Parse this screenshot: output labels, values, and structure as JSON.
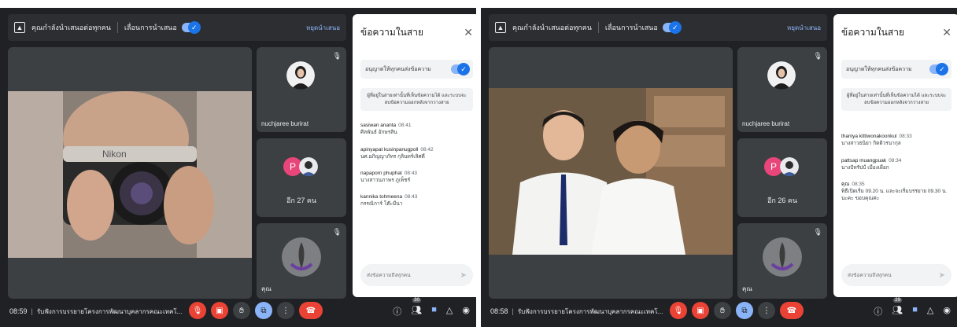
{
  "panes": [
    {
      "banner": {
        "text": "คุณกำลังนำเสนอต่อทุกคน",
        "toggle_label": "เลื่อนการนำเสนอ",
        "stop_label": "หยุดนำเสนอ"
      },
      "tiles": [
        {
          "name": "nuchjaree burirat"
        },
        {
          "avatar_letter": "P",
          "more_label": "อีก 27 คน"
        },
        {
          "name": "คุณ"
        }
      ],
      "chat": {
        "title": "ข้อความในสาย",
        "allow_label": "อนุญาตให้ทุกคนส่งข้อความ",
        "notice": "ผู้ที่อยู่ในสายเท่านั้นที่เห็นข้อความได้ และระบบจะลบข้อความออกหลังจากวางสาย",
        "messages": [
          {
            "sender": "sasiwan ananta",
            "time": "08:41",
            "text": "ศิลพันธ์ อักษรสิน"
          },
          {
            "sender": "apinyapat kusinpanugpoll",
            "time": "08:42",
            "text": "นศ.อภิญญาภัทร กุลินทร์เลิศดี"
          },
          {
            "sender": "napaporn phuphat",
            "time": "08:43",
            "text": "นางสาวนภาพร ภูเพ็ชร์"
          },
          {
            "sender": "kannika tohmeena",
            "time": "08:43",
            "text": "กรรณิการ์ โต๊ะมีนา"
          }
        ],
        "input_placeholder": "ส่งข้อความถึงทุกคน"
      },
      "bottom": {
        "time": "08:59",
        "title": "รับฟังการบรรยายโครงการพัฒนาบุคลากรคณะเทคโ..."
      },
      "people_count": "30"
    },
    {
      "banner": {
        "text": "คุณกำลังนำเสนอต่อทุกคน",
        "toggle_label": "เลื่อนการนำเสนอ",
        "stop_label": "หยุดนำเสนอ"
      },
      "tiles": [
        {
          "name": "nuchjaree burirat"
        },
        {
          "avatar_letter": "P",
          "more_label": "อีก 26 คน"
        },
        {
          "name": "คุณ"
        }
      ],
      "chat": {
        "title": "ข้อความในสาย",
        "allow_label": "อนุญาตให้ทุกคนส่งข้อความ",
        "notice": "ผู้ที่อยู่ในสายเท่านั้นที่เห็นข้อความได้ และระบบจะลบข้อความออกหลังจากวางสาย",
        "messages": [
          {
            "sender": "thaniya kittiwonakoonkul",
            "time": "08:33",
            "text": "นางสาวธนิยา กิตติวรนากุล"
          },
          {
            "sender": "pattsap muangpuak",
            "time": "08:34",
            "text": "นางปัทรัปป์ เมืองเผือก"
          },
          {
            "sender": "คุณ",
            "time": "08:35",
            "text": "พิธีเปิดเริ่ม 09.20 น. และจะเริ่มบรรยาย 09.30 น. นะคะ ขอบคุณค่ะ"
          }
        ],
        "input_placeholder": "ส่งข้อความถึงทุกคน"
      },
      "bottom": {
        "time": "08:58",
        "title": "รับฟังการบรรยายโครงการพัฒนาบุคลากรคณะเทคโ..."
      },
      "people_count": "29"
    }
  ],
  "icons": {
    "present": "present-to-all-icon",
    "mic_off": "mic-off-icon",
    "cam_off": "videocam-off-icon",
    "hand": "raise-hand-icon",
    "present_ctrl": "present-icon",
    "more": "more-vert-icon",
    "end": "call-end-icon",
    "info": "info-icon",
    "people": "people-icon",
    "chat": "chat-icon",
    "activities": "activities-icon",
    "host": "host-controls-icon"
  },
  "colors": {
    "background": "#202124",
    "tile": "#3c4043",
    "accent": "#1a73e8",
    "danger": "#ea4335",
    "avatar_p": "#e8457a"
  }
}
